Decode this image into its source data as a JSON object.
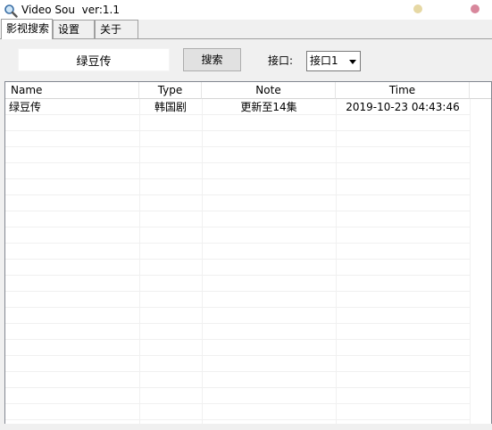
{
  "window": {
    "title": "Video Sou  ver:1.1",
    "icon": "search-icon",
    "dots": {
      "minimize_color": "#e6d8a4",
      "close_color": "#d8879c"
    }
  },
  "tabs": [
    {
      "label": "影视搜索",
      "active": true
    },
    {
      "label": "设置",
      "active": false
    },
    {
      "label": "关于",
      "active": false
    }
  ],
  "search": {
    "query": "绿豆传",
    "button_label": "搜索",
    "interface_label": "接口:",
    "interface_value": "接口1"
  },
  "table": {
    "columns": [
      "Name",
      "Type",
      "Note",
      "Time"
    ],
    "rows": [
      {
        "name": "绿豆传",
        "type": "韩国剧",
        "note": "更新至14集",
        "time": "2019-10-23 04:43:46"
      }
    ]
  },
  "colors": {
    "window_bg": "#f0f0f0",
    "list_bg": "#ffffff",
    "gridline": "#f0f0f0",
    "border": "#828790"
  }
}
